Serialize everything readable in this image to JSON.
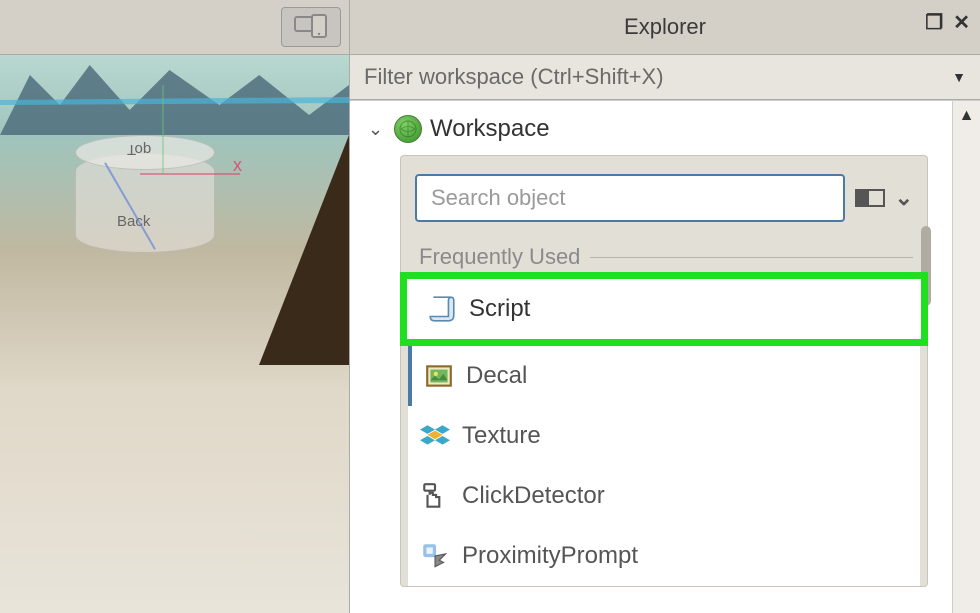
{
  "panel": {
    "title": "Explorer",
    "filter_placeholder": "Filter workspace (Ctrl+Shift+X)"
  },
  "tree": {
    "root_label": "Workspace"
  },
  "insert": {
    "search_placeholder": "Search object",
    "section_label": "Frequently Used",
    "items": [
      {
        "label": "Script"
      },
      {
        "label": "Decal"
      },
      {
        "label": "Texture"
      },
      {
        "label": "ClickDetector"
      },
      {
        "label": "ProximityPrompt"
      }
    ]
  },
  "viewport": {
    "face_top": "Top",
    "face_back": "Back"
  }
}
